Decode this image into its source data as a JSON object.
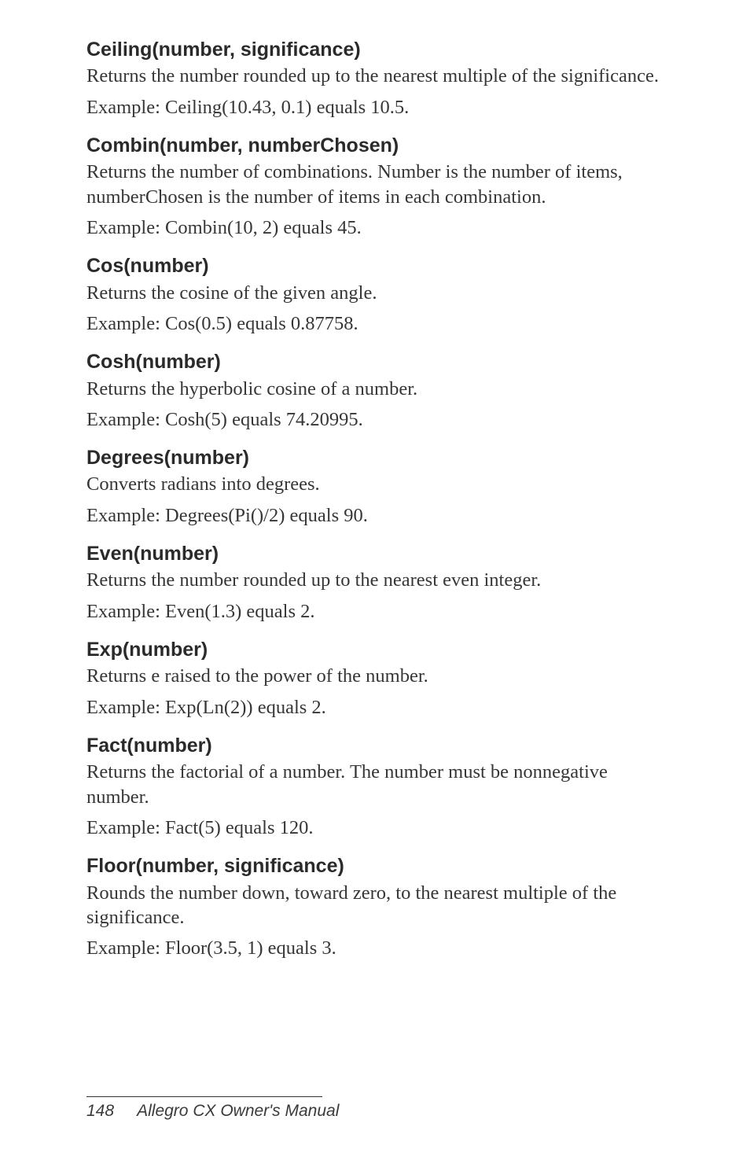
{
  "sections": [
    {
      "heading": "Ceiling(number, significance)",
      "desc": "Returns the number rounded up to the nearest multiple of the significance.",
      "example": "Example: Ceiling(10.43, 0.1) equals 10.5."
    },
    {
      "heading": "Combin(number, numberChosen)",
      "desc": "Returns the number of combinations. Number is the number of items, numberChosen is the number of items in each combination.",
      "example": "Example: Combin(10, 2) equals 45."
    },
    {
      "heading": "Cos(number)",
      "desc": "Returns the cosine of the given angle.",
      "example": "Example: Cos(0.5) equals 0.87758."
    },
    {
      "heading": "Cosh(number)",
      "desc": "Returns the hyperbolic cosine of a number.",
      "example": "Example: Cosh(5) equals 74.20995."
    },
    {
      "heading": "Degrees(number)",
      "desc": "Converts radians into degrees.",
      "example": "Example: Degrees(Pi()/2) equals 90."
    },
    {
      "heading": "Even(number)",
      "desc": "Returns the number rounded up to the nearest even integer.",
      "example": "Example: Even(1.3) equals 2."
    },
    {
      "heading": "Exp(number)",
      "desc": "Returns e raised to the power of the number.",
      "example": "Example: Exp(Ln(2)) equals 2."
    },
    {
      "heading": "Fact(number)",
      "desc": "Returns the factorial of a number. The number must be nonnegative number.",
      "example": "Example: Fact(5) equals 120."
    },
    {
      "heading": "Floor(number, significance)",
      "desc": "Rounds the number down, toward zero, to the nearest multiple of the significance.",
      "example": "Example: Floor(3.5, 1) equals 3."
    }
  ],
  "footer": {
    "page": "148",
    "title": "Allegro CX Owner's Manual"
  }
}
